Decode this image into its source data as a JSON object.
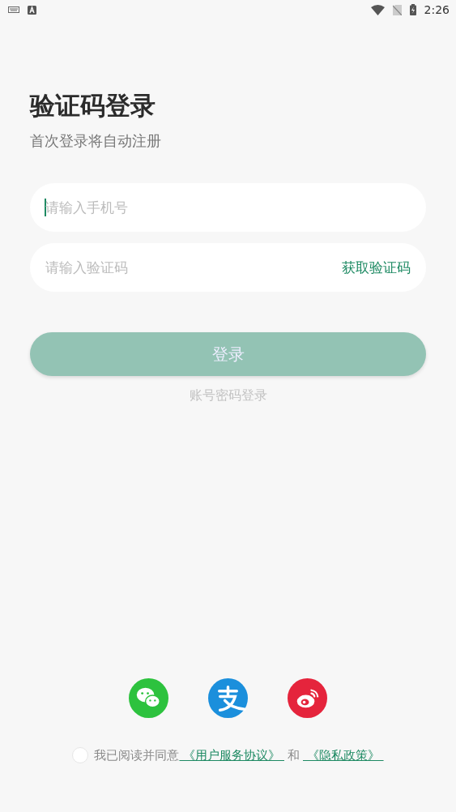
{
  "status_bar": {
    "time": "2:26"
  },
  "title": "验证码登录",
  "subtitle": "首次登录将自动注册",
  "phone_field": {
    "placeholder": "请输入手机号",
    "focused": true
  },
  "code_field": {
    "placeholder": "请输入验证码",
    "action": "获取验证码"
  },
  "login_button": {
    "label": "登录",
    "disabled": true
  },
  "password_login_link": "账号密码登录",
  "social_logins": [
    {
      "kind": "wechat"
    },
    {
      "kind": "alipay"
    },
    {
      "kind": "weibo"
    }
  ],
  "agreement": {
    "checked": false,
    "text": "我已阅读并同意",
    "link_1": " 《用户服务协议》 ",
    "joiner": "和",
    "link_2": " 《隐私政策》 "
  }
}
